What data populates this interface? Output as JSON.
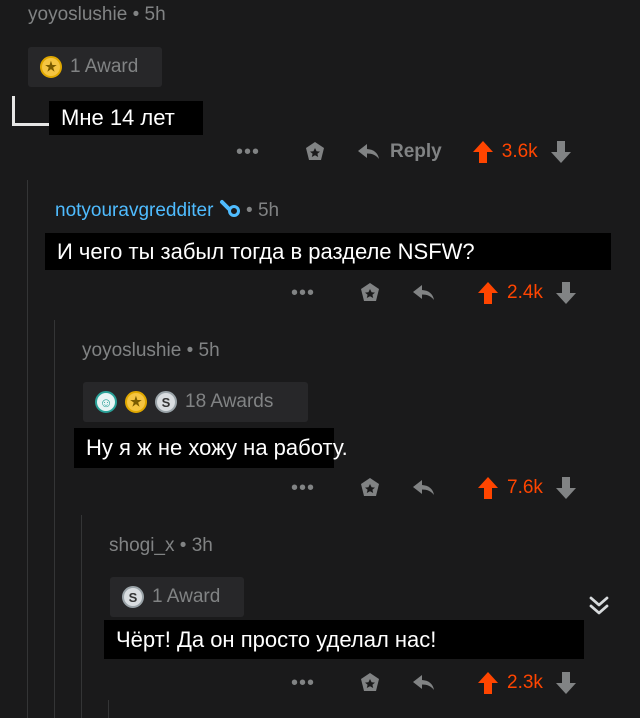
{
  "comments": [
    {
      "username": "yoyoslushie",
      "time": "5h",
      "awards_label": "1 Award",
      "text": "Мне 14 лет",
      "reply_label": "Reply",
      "votes": "3.6k"
    },
    {
      "username": "notyouravgredditer",
      "time": "5h",
      "text": "И чего ты забыл тогда в разделе NSFW?",
      "votes": "2.4k"
    },
    {
      "username": "yoyoslushie",
      "time": "5h",
      "awards_label": "18 Awards",
      "text": "Ну я ж не хожу на работу.",
      "votes": "7.6k"
    },
    {
      "username": "shogi_x",
      "time": "3h",
      "awards_label": "1 Award",
      "text": "Чёрт! Да он просто уделал нас!",
      "votes": "2.3k"
    }
  ],
  "separator": "•",
  "more_dots": "•••",
  "colors": {
    "background": "#1a1a1b",
    "upvote": "#ff4500",
    "meta_text": "#818384",
    "flair_user": "#4fbcff"
  }
}
